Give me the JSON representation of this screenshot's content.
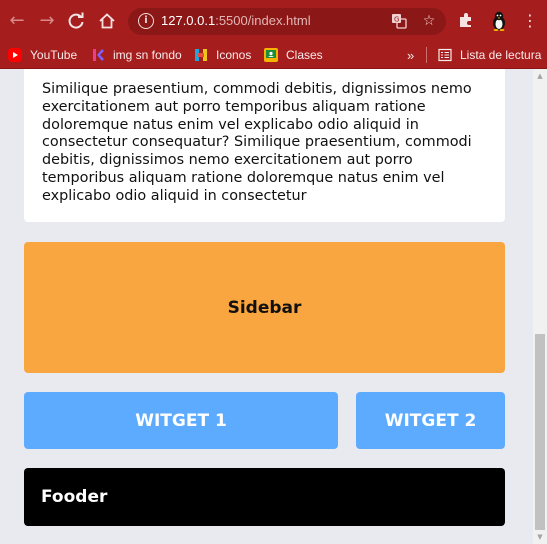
{
  "browser": {
    "url_host": "127.0.0.1",
    "url_rest": ":5500/index.html",
    "bookmarks": [
      {
        "label": "YouTube",
        "icon": "youtube-icon",
        "color": "#ff0000"
      },
      {
        "label": "img sn fondo",
        "icon": "kapwing-icon",
        "color": "#e83e8c"
      },
      {
        "label": "Iconos",
        "icon": "iconos-icon",
        "color": "#19a7e0"
      },
      {
        "label": "Clases",
        "icon": "classroom-icon",
        "color": "#f4b400"
      }
    ],
    "overflow": "»",
    "reading_list": "Lista de lectura"
  },
  "page": {
    "paragraph": "Similique praesentium, commodi debitis, dignissimos nemo exercitationem aut porro temporibus aliquam ratione doloremque natus enim vel explicabo odio aliquid in consectetur consequatur? Similique praesentium, commodi debitis, dignissimos nemo exercitationem aut porro temporibus aliquam ratione doloremque natus enim vel explicabo odio aliquid in consectetur",
    "sidebar": "Sidebar",
    "widget1": "WITGET 1",
    "widget2": "WITGET 2",
    "footer": "Fooder"
  },
  "colors": {
    "browser_chrome": "#a51d1d",
    "sidebar": "#f9a641",
    "widget": "#5cabff",
    "footer": "#000000"
  }
}
